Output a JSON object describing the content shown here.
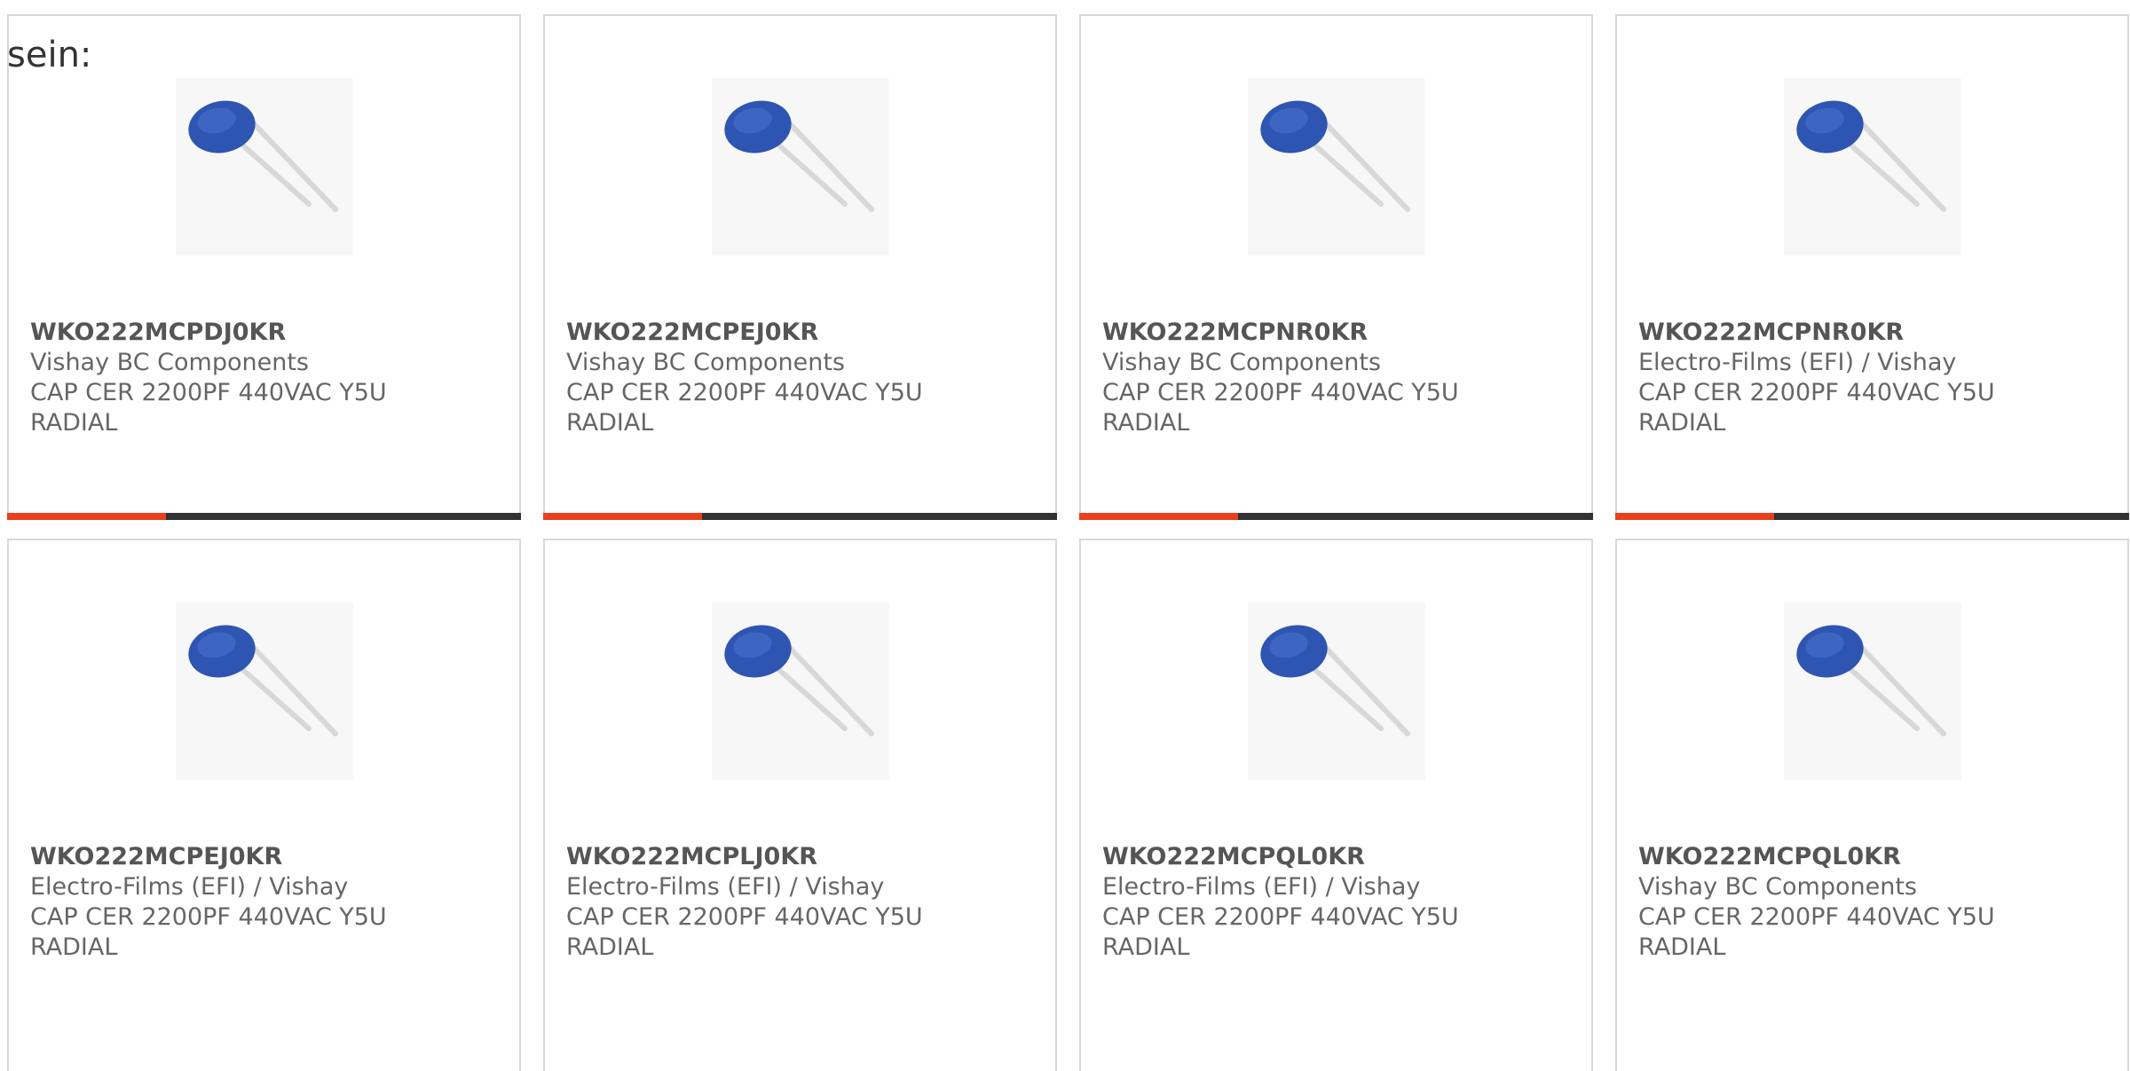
{
  "intro_text": "sein:",
  "colors": {
    "accent": "#e8401c",
    "bar_track": "#333333",
    "text": "#666666",
    "border": "#d9d9d9"
  },
  "products": [
    {
      "part_number": "WKO222MCPDJ0KR",
      "manufacturer": "Vishay BC Components",
      "desc_line1": "CAP CER 2200PF 440VAC Y5U",
      "desc_line2": "RADIAL",
      "image_icon": "radial-capacitor-icon",
      "progress": 0.31
    },
    {
      "part_number": "WKO222MCPEJ0KR",
      "manufacturer": "Vishay BC Components",
      "desc_line1": "CAP CER 2200PF 440VAC Y5U",
      "desc_line2": "RADIAL",
      "image_icon": "radial-capacitor-icon",
      "progress": 0.31
    },
    {
      "part_number": "WKO222MCPNR0KR",
      "manufacturer": "Vishay BC Components",
      "desc_line1": "CAP CER 2200PF 440VAC Y5U",
      "desc_line2": "RADIAL",
      "image_icon": "radial-capacitor-icon",
      "progress": 0.31
    },
    {
      "part_number": "WKO222MCPNR0KR",
      "manufacturer": "Electro-Films (EFI) / Vishay",
      "desc_line1": "CAP CER 2200PF 440VAC Y5U",
      "desc_line2": "RADIAL",
      "image_icon": "radial-capacitor-icon",
      "progress": 0.31
    },
    {
      "part_number": "WKO222MCPEJ0KR",
      "manufacturer": "Electro-Films (EFI) / Vishay",
      "desc_line1": "CAP CER 2200PF 440VAC Y5U",
      "desc_line2": "RADIAL",
      "image_icon": "radial-capacitor-icon"
    },
    {
      "part_number": "WKO222MCPLJ0KR",
      "manufacturer": "Electro-Films (EFI) / Vishay",
      "desc_line1": "CAP CER 2200PF 440VAC Y5U",
      "desc_line2": "RADIAL",
      "image_icon": "radial-capacitor-icon"
    },
    {
      "part_number": "WKO222MCPQL0KR",
      "manufacturer": "Electro-Films (EFI) / Vishay",
      "desc_line1": "CAP CER 2200PF 440VAC Y5U",
      "desc_line2": "RADIAL",
      "image_icon": "radial-capacitor-icon"
    },
    {
      "part_number": "WKO222MCPQL0KR",
      "manufacturer": "Vishay BC Components",
      "desc_line1": "CAP CER 2200PF 440VAC Y5U",
      "desc_line2": "RADIAL",
      "image_icon": "radial-capacitor-icon"
    }
  ]
}
